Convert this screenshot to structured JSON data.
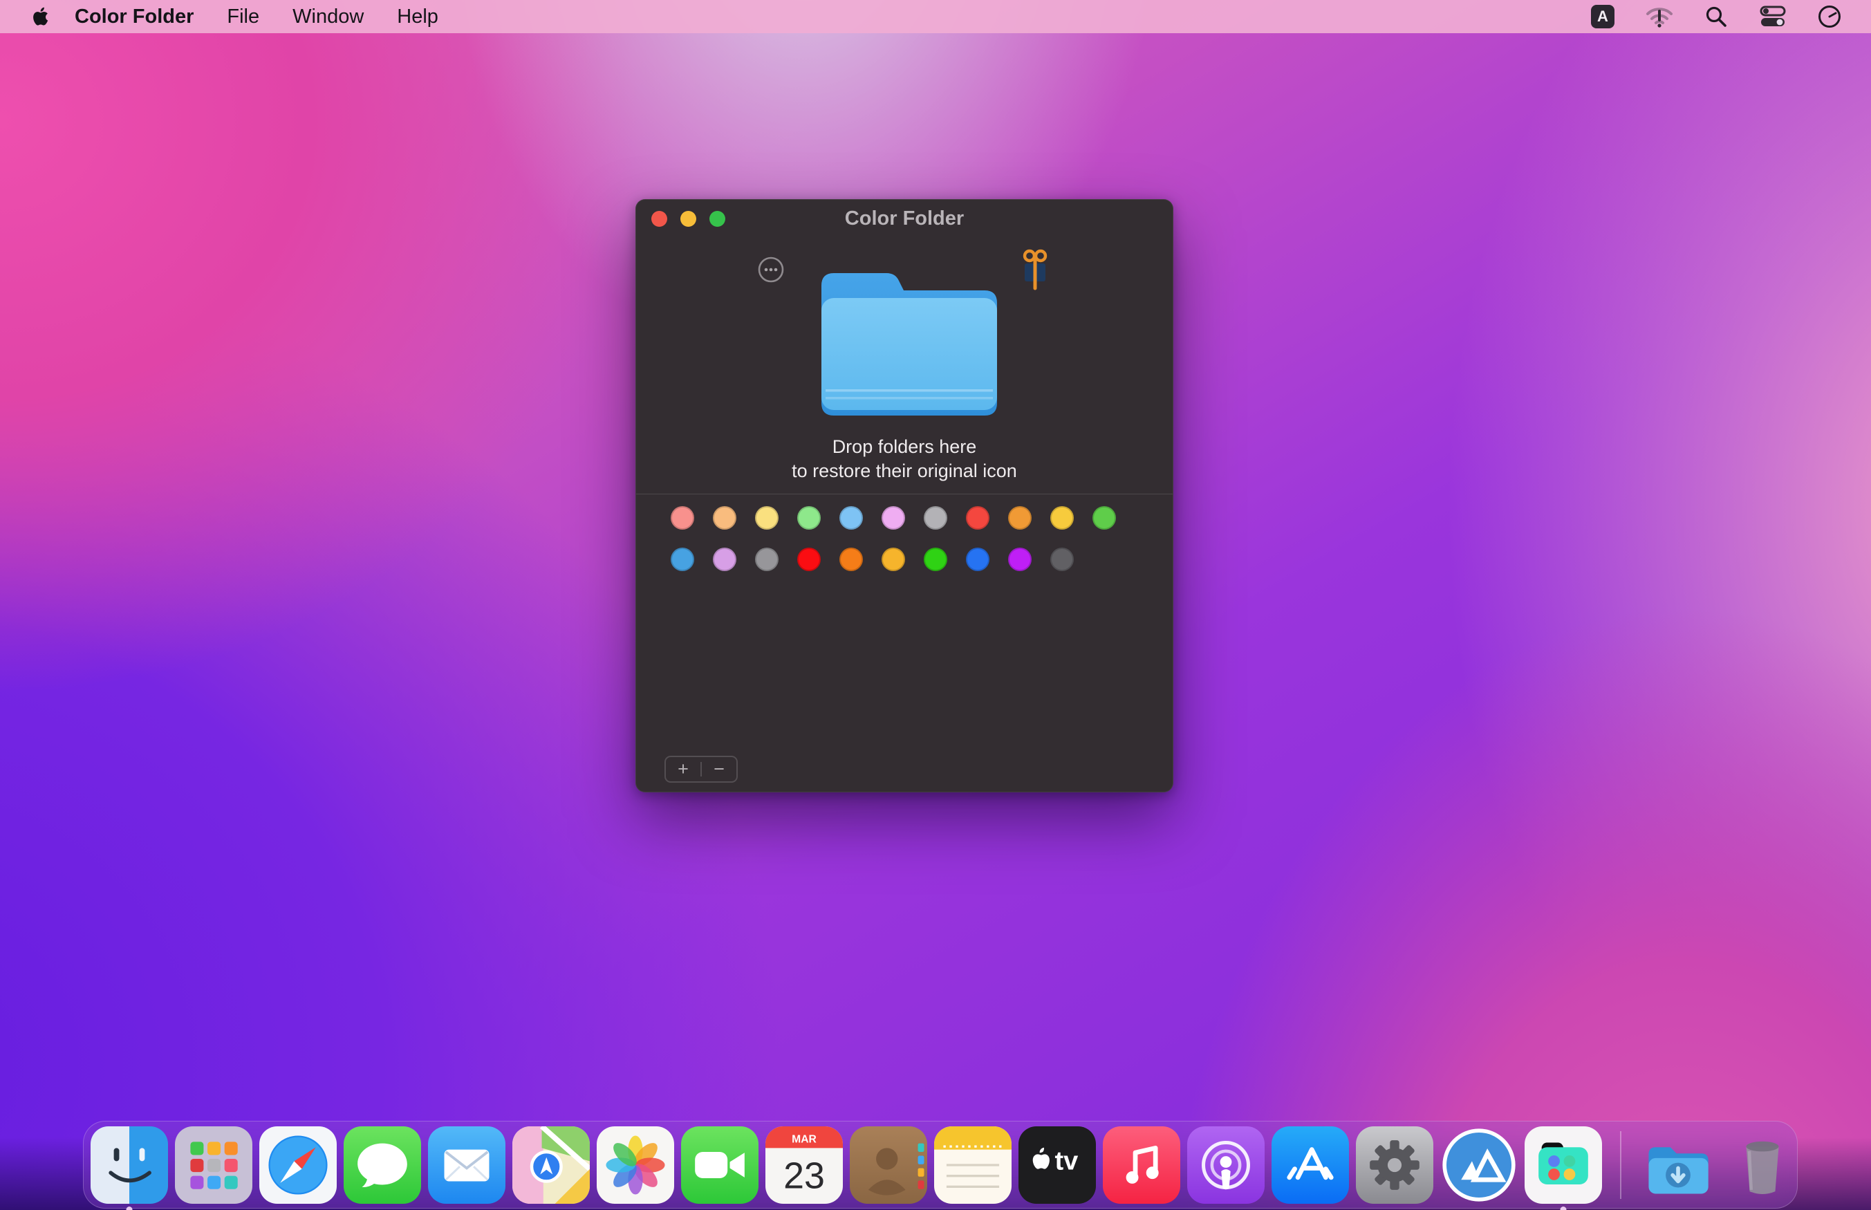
{
  "menu_bar": {
    "menus": [
      "Color Folder",
      "File",
      "Window",
      "Help"
    ],
    "status_icons": [
      "keyboard-input-icon",
      "wifi-alert-icon",
      "search-icon",
      "control-center-icon",
      "clock-icon"
    ],
    "keyboard_badge": "A",
    "bg_color": "#f0add4"
  },
  "window": {
    "title": "Color Folder",
    "drop_hint_line1": "Drop folders here",
    "drop_hint_line2": "to restore their original icon",
    "add_label": "+",
    "remove_label": "−",
    "bg_color": "#332d31",
    "palette_row1": [
      {
        "name": "salmon",
        "color": "#f8918d"
      },
      {
        "name": "peach",
        "color": "#f9bc7e"
      },
      {
        "name": "lemon",
        "color": "#fae07f"
      },
      {
        "name": "mint",
        "color": "#8ee88b"
      },
      {
        "name": "sky",
        "color": "#7ec3f4"
      },
      {
        "name": "lilac",
        "color": "#efadf2"
      },
      {
        "name": "light-gray",
        "color": "#b3b2b6"
      },
      {
        "name": "red",
        "color": "#f4473f"
      },
      {
        "name": "orange",
        "color": "#f09a35"
      },
      {
        "name": "gold",
        "color": "#f7cb3d"
      },
      {
        "name": "green",
        "color": "#5fcd4a"
      }
    ],
    "palette_row2": [
      {
        "name": "blue",
        "color": "#47a2e2"
      },
      {
        "name": "orchid",
        "color": "#d79fe6"
      },
      {
        "name": "gray",
        "color": "#97969a"
      },
      {
        "name": "bright-red",
        "color": "#fb0d12"
      },
      {
        "name": "bright-orange",
        "color": "#f57d18"
      },
      {
        "name": "amber",
        "color": "#f6b42c"
      },
      {
        "name": "bright-green",
        "color": "#2fd214"
      },
      {
        "name": "royal-blue",
        "color": "#2673f2"
      },
      {
        "name": "purple",
        "color": "#bf1ff6"
      },
      {
        "name": "dark-gray",
        "color": "#616064"
      }
    ]
  },
  "dock": {
    "items": [
      {
        "icon": "finder",
        "running": true
      },
      {
        "icon": "launchpad"
      },
      {
        "icon": "safari"
      },
      {
        "icon": "messages"
      },
      {
        "icon": "mail"
      },
      {
        "icon": "maps"
      },
      {
        "icon": "photos"
      },
      {
        "icon": "facetime"
      },
      {
        "icon": "calendar",
        "month": "MAR",
        "day": "23"
      },
      {
        "icon": "contacts"
      },
      {
        "icon": "notes"
      },
      {
        "icon": "appletv",
        "label": "tv"
      },
      {
        "icon": "music"
      },
      {
        "icon": "podcasts"
      },
      {
        "icon": "appstore"
      },
      {
        "icon": "system-preferences"
      },
      {
        "icon": "mountain-app"
      },
      {
        "icon": "color-folder-app",
        "running": true
      },
      {
        "icon": "separator"
      },
      {
        "icon": "downloads"
      },
      {
        "icon": "trash"
      }
    ]
  }
}
